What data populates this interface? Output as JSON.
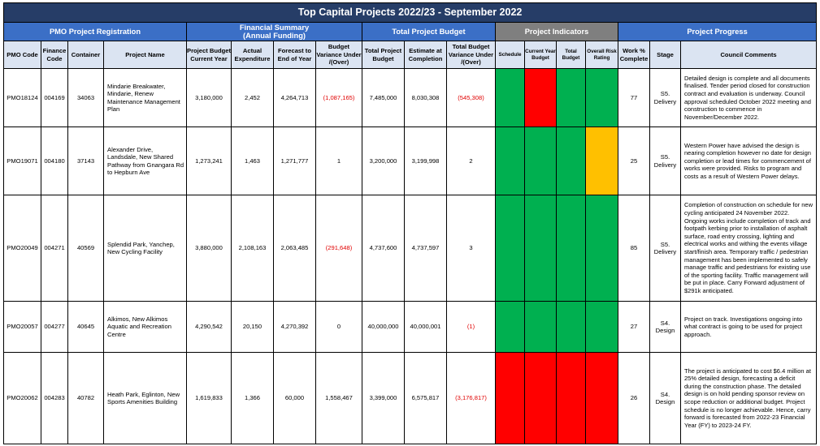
{
  "title": "Top Capital Projects 2022/23 - September 2022",
  "group_headers": {
    "registration": "PMO Project Registration",
    "financial_line1": "Financial Summary",
    "financial_line2": "(Annual Funding)",
    "total_budget": "Total Project Budget",
    "indicators": "Project Indicators",
    "progress": "Project Progress"
  },
  "columns": {
    "pmo_code": "PMO Code",
    "finance_code": "Finance Code",
    "container": "Container",
    "project_name": "Project Name",
    "budget_current_year": "Project Budget Current Year",
    "actual_expenditure": "Actual Expenditure",
    "forecast": "Forecast to End of Year",
    "budget_variance": "Budget Variance Under /(Over)",
    "total_project_budget": "Total Project Budget",
    "estimate_completion": "Estimate at Completion",
    "total_budget_variance": "Total Budget Variance Under /(Over)",
    "schedule": "Schedule",
    "current_year_budget": "Current Year Budget",
    "total_budget": "Total Budget",
    "overall_risk": "Overall Risk Rating",
    "work_complete": "Work % Complete",
    "stage": "Stage",
    "comments": "Council Comments"
  },
  "indicator_colors": {
    "green": "#00b050",
    "red": "#ff0000",
    "amber": "#ffc000"
  },
  "rows": [
    {
      "pmo_code": "PMO18124",
      "finance_code": "004169",
      "container": "34063",
      "project_name": "Mindarie Breakwater, Mindarie, Renew Maintenance Management Plan",
      "budget_current_year": "3,180,000",
      "actual_expenditure": "2,452",
      "forecast": "4,264,713",
      "budget_variance": "(1,087,165)",
      "total_project_budget": "7,485,000",
      "estimate_completion": "8,030,308",
      "total_budget_variance": "(545,308)",
      "indicators": [
        "green",
        "red",
        "green",
        "green"
      ],
      "work_complete": "77",
      "stage_line1": "S5.",
      "stage_line2": "Delivery",
      "comments": "Detailed design is complete and all documents finalised. Tender period closed for construction contract and evaluation is underway. Council approval scheduled October 2022 meeting and construction to commence in November/December 2022."
    },
    {
      "pmo_code": "PMO19071",
      "finance_code": "004180",
      "container": "37143",
      "project_name": "Alexander Drive, Landsdale, New Shared Pathway from Gnangara Rd to Hepburn Ave",
      "budget_current_year": "1,273,241",
      "actual_expenditure": "1,463",
      "forecast": "1,271,777",
      "budget_variance": "1",
      "total_project_budget": "3,200,000",
      "estimate_completion": "3,199,998",
      "total_budget_variance": "2",
      "indicators": [
        "green",
        "green",
        "green",
        "amber"
      ],
      "work_complete": "25",
      "stage_line1": "S5.",
      "stage_line2": "Delivery",
      "comments": "Western Power have advised the design is nearing completion however no date for design completion or lead times for commencement of works were provided. Risks to program and costs as a result of Western Power delays."
    },
    {
      "pmo_code": "PMO20049",
      "finance_code": "004271",
      "container": "40569",
      "project_name": "Splendid Park, Yanchep, New Cycling Facility",
      "budget_current_year": "3,880,000",
      "actual_expenditure": "2,108,163",
      "forecast": "2,063,485",
      "budget_variance": "(291,648)",
      "total_project_budget": "4,737,600",
      "estimate_completion": "4,737,597",
      "total_budget_variance": "3",
      "indicators": [
        "green",
        "green",
        "green",
        "green"
      ],
      "work_complete": "85",
      "stage_line1": "S5.",
      "stage_line2": "Delivery",
      "comments": "Completion of construction on schedule for new cycling anticipated 24 November 2022. Ongoing works include completion of track and footpath kerbing prior to installation of asphalt surface, road entry crossing, lighting and electrical works and withing the events village start/finish area. Temporary traffic / pedestrian management has been implemented to safely manage traffic and pedestrians for existing use of the sporting facility. Traffic management will be put in place. Carry Forward adjustment of $291k anticipated."
    },
    {
      "pmo_code": "PMO20057",
      "finance_code": "004277",
      "container": "40645",
      "project_name": "Alkimos, New Alkimos Aquatic and Recreation Centre",
      "budget_current_year": "4,290,542",
      "actual_expenditure": "20,150",
      "forecast": "4,270,392",
      "budget_variance": "0",
      "total_project_budget": "40,000,000",
      "estimate_completion": "40,000,001",
      "total_budget_variance": "(1)",
      "indicators": [
        "green",
        "green",
        "green",
        "green"
      ],
      "work_complete": "27",
      "stage_line1": "S4.",
      "stage_line2": "Design",
      "comments": "Project on track. Investigations ongoing into what contract is going to be used for project approach."
    },
    {
      "pmo_code": "PMO20062",
      "finance_code": "004283",
      "container": "40782",
      "project_name": "Heath Park, Eglinton, New Sports Amenities Building",
      "budget_current_year": "1,619,833",
      "actual_expenditure": "1,366",
      "forecast": "60,000",
      "budget_variance": "1,558,467",
      "total_project_budget": "3,399,000",
      "estimate_completion": "6,575,817",
      "total_budget_variance": "(3,176,817)",
      "indicators": [
        "red",
        "red",
        "red",
        "red"
      ],
      "work_complete": "26",
      "stage_line1": "S4.",
      "stage_line2": "Design",
      "comments": "The project is anticipated to cost $6.4 million at 25% detailed design, forecasting a deficit during the construction phase. The detailed design is on hold pending sponsor review on scope reduction or additional budget. Project schedule is no longer achievable. Hence, carry forward is forecasted from 2022-23 Financial Year (FY) to 2023-24 FY."
    }
  ]
}
